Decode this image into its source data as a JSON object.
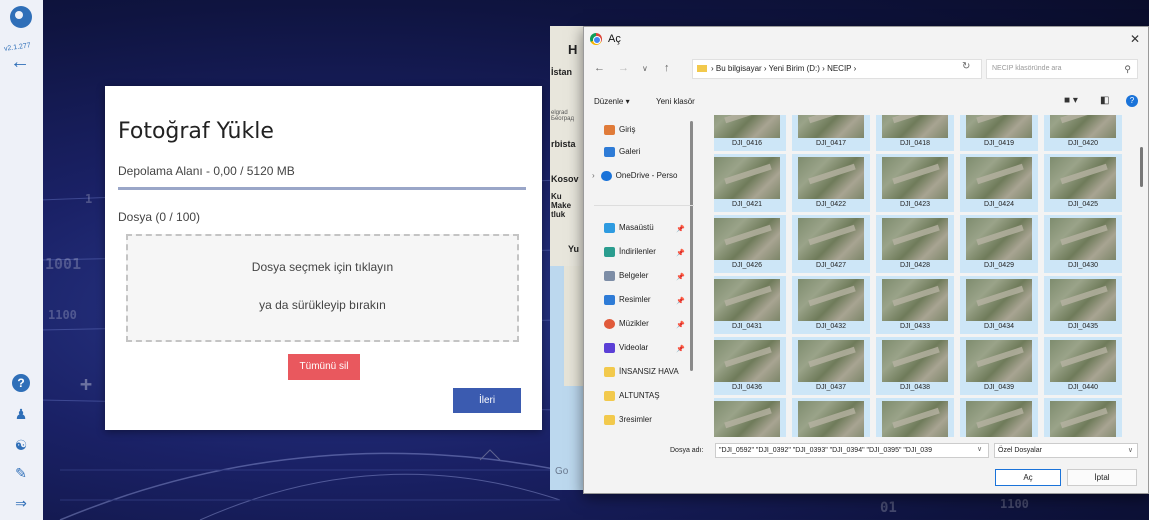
{
  "sidebar": {
    "version": "v2.1.277",
    "back_glyph": "←"
  },
  "upload_dialog": {
    "title": "Fotoğraf Yükle",
    "storage_label": "Depolama Alanı - 0,00 / 5120 MB",
    "file_count_label": "Dosya (0 / 100)",
    "drop_line1": "Dosya seçmek için tıklayın",
    "drop_line2": "ya da sürükleyip bırakın",
    "delete_all_label": "Tümünü sil",
    "next_label": "İleri"
  },
  "map": {
    "labels": [
      "H",
      "İstan",
      "elgrad\nБеоград",
      "rbista",
      "Kosov",
      "Ku\nMake\ntluk",
      "Yu"
    ],
    "attribution": "Go"
  },
  "file_dialog": {
    "title": "Aç",
    "close_glyph": "✕",
    "breadcrumb": [
      "Bu bilgisayar",
      "Yeni Birim (D:)",
      "NECIP"
    ],
    "search_placeholder": "NECIP klasöründe ara",
    "toolbar": {
      "organize_label": "Düzenle ▾",
      "new_folder_label": "Yeni klasör"
    },
    "sidebar_items": [
      {
        "label": "Giriş",
        "icon": "home-icon",
        "color": "#e07b39"
      },
      {
        "label": "Galeri",
        "icon": "gallery-icon",
        "color": "#2e7bd6"
      },
      {
        "label": "OneDrive - Perso",
        "icon": "cloud-icon",
        "color": "#1a73d9"
      },
      {
        "label": "Masaüstü",
        "icon": "desktop-icon",
        "color": "#2e9be0"
      },
      {
        "label": "İndirilenler",
        "icon": "download-icon",
        "color": "#2a9d8f"
      },
      {
        "label": "Belgeler",
        "icon": "documents-icon",
        "color": "#7d8da6"
      },
      {
        "label": "Resimler",
        "icon": "pictures-icon",
        "color": "#2e7bd6"
      },
      {
        "label": "Müzikler",
        "icon": "music-icon",
        "color": "#e05a3a"
      },
      {
        "label": "Videolar",
        "icon": "videos-icon",
        "color": "#5b3fd6"
      },
      {
        "label": "İNSANSIZ HAVA",
        "icon": "folder-icon",
        "color": "#f2c94c"
      },
      {
        "label": "ALTUNTAŞ",
        "icon": "folder-icon",
        "color": "#f2c94c"
      },
      {
        "label": "3resimler",
        "icon": "folder-icon",
        "color": "#f2c94c"
      }
    ],
    "files": [
      "DJI_0416",
      "DJI_0417",
      "DJI_0418",
      "DJI_0419",
      "DJI_0420",
      "DJI_0421",
      "DJI_0422",
      "DJI_0423",
      "DJI_0424",
      "DJI_0425",
      "DJI_0426",
      "DJI_0427",
      "DJI_0428",
      "DJI_0429",
      "DJI_0430",
      "DJI_0431",
      "DJI_0432",
      "DJI_0433",
      "DJI_0434",
      "DJI_0435",
      "DJI_0436",
      "DJI_0437",
      "DJI_0438",
      "DJI_0439",
      "DJI_0440",
      "",
      "",
      "",
      "",
      ""
    ],
    "filename_label": "Dosya adı:",
    "filename_value": "\"DJI_0592\" \"DJI_0392\" \"DJI_0393\" \"DJI_0394\" \"DJI_0395\" \"DJI_039",
    "filetype_value": "Özel Dosyalar",
    "open_label": "Aç",
    "cancel_label": "İptal"
  },
  "colors": {
    "accent_blue": "#3b5bb0",
    "delete_red": "#e9585e",
    "selection_blue": "#cde6f7"
  }
}
